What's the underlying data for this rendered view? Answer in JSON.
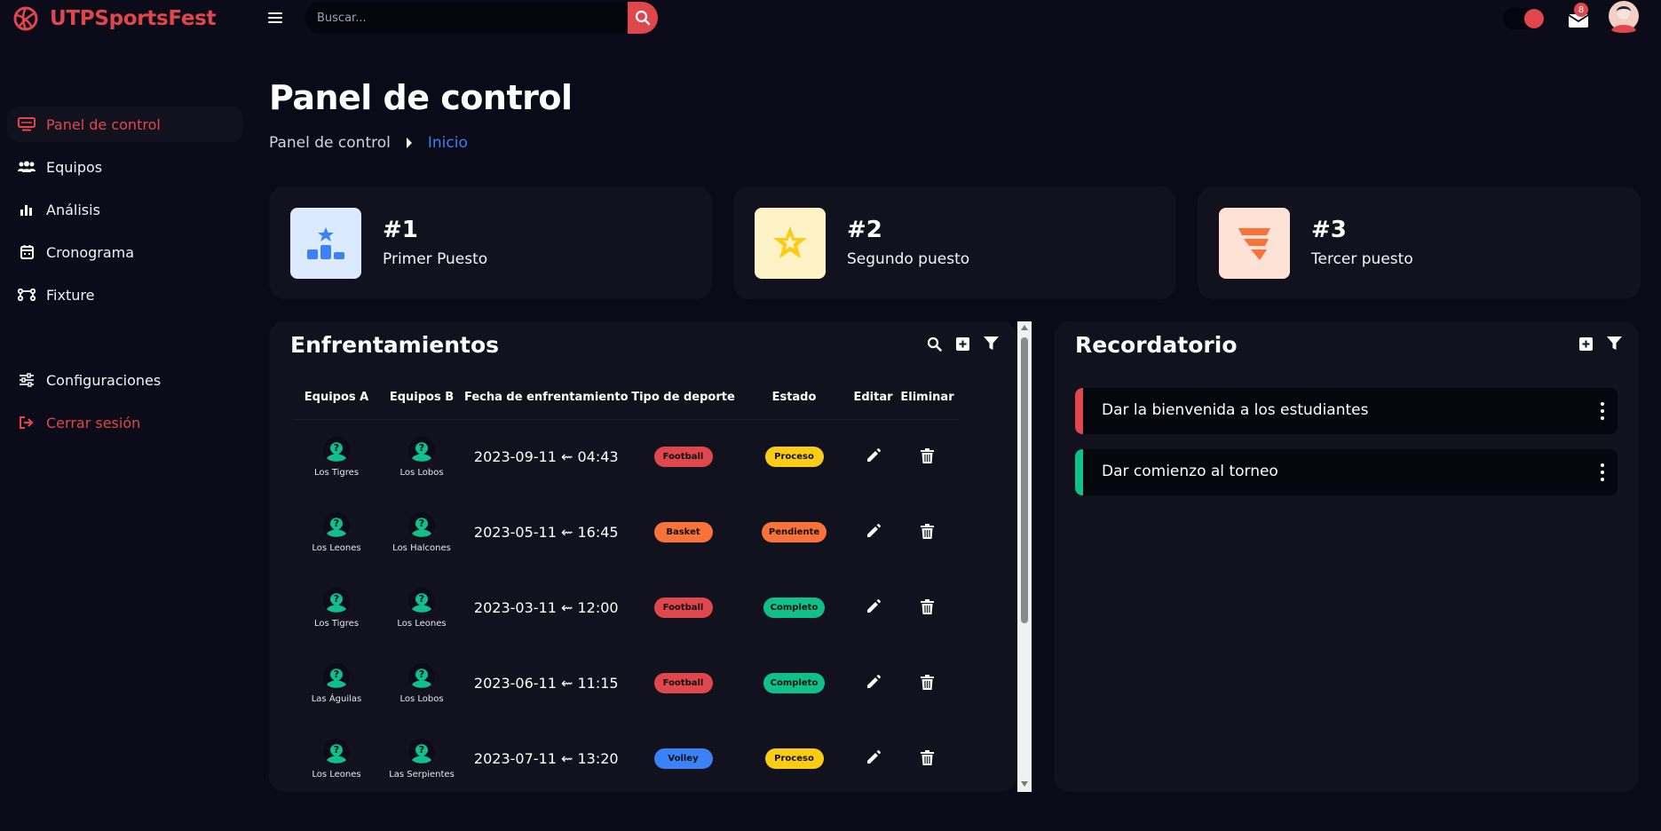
{
  "app": {
    "name": "UTPSportsFest",
    "accent": "#e0474c"
  },
  "search": {
    "placeholder": "Buscar..."
  },
  "notifications": {
    "count": "8"
  },
  "sidebar": {
    "items": [
      {
        "label": "Panel de control",
        "icon": "dashboard-icon"
      },
      {
        "label": "Equipos",
        "icon": "users-icon"
      },
      {
        "label": "Análisis",
        "icon": "bar-chart-icon"
      },
      {
        "label": "Cronograma",
        "icon": "calendar-icon"
      },
      {
        "label": "Fixture",
        "icon": "bracket-icon"
      },
      {
        "label": "Configuraciones",
        "icon": "sliders-icon"
      },
      {
        "label": "Cerrar sesión",
        "icon": "logout-icon"
      }
    ]
  },
  "page": {
    "title": "Panel de control",
    "breadcrumb": {
      "first": "Panel de control",
      "current": "Inicio"
    }
  },
  "cards": [
    {
      "rank": "#1",
      "label": "Primer Puesto",
      "icon": "podium-icon",
      "bg": "#dbeafe"
    },
    {
      "rank": "#2",
      "label": "Segundo puesto",
      "icon": "star-icon",
      "bg": "#fef3c7"
    },
    {
      "rank": "#3",
      "label": "Tercer puesto",
      "icon": "stack-icon",
      "bg": "#fee2d5"
    }
  ],
  "matches": {
    "title": "Enfrentamientos",
    "columns": [
      "Equipos A",
      "Equipos B",
      "Fecha de enfrentamiento",
      "Tipo de deporte",
      "Estado",
      "Editar",
      "Eliminar"
    ],
    "rows": [
      {
        "team_a": "Los Tigres",
        "team_b": "Los Lobos",
        "date": "2023-09-11 ⇜ 04:43",
        "sport": "Football",
        "status": "Proceso"
      },
      {
        "team_a": "Los Leones",
        "team_b": "Los Halcones",
        "date": "2023-05-11 ⇜ 16:45",
        "sport": "Basket",
        "status": "Pendiente"
      },
      {
        "team_a": "Los Tigres",
        "team_b": "Los Leones",
        "date": "2023-03-11 ⇜ 12:00",
        "sport": "Football",
        "status": "Completo"
      },
      {
        "team_a": "Las Águilas",
        "team_b": "Los Lobos",
        "date": "2023-06-11 ⇜ 11:15",
        "sport": "Football",
        "status": "Completo"
      },
      {
        "team_a": "Los Leones",
        "team_b": "Las Serpientes",
        "date": "2023-07-11 ⇜ 13:20",
        "sport": "Volley",
        "status": "Proceso"
      }
    ],
    "sport_colors": {
      "Football": "#e0474c",
      "Basket": "#f97339",
      "Volley": "#3b82f6"
    },
    "status_colors": {
      "Proceso": "#facc15",
      "Pendiente": "#f97339",
      "Completo": "#10c08a"
    }
  },
  "reminders": {
    "title": "Recordatorio",
    "items": [
      {
        "text": "Dar la bienvenida a los estudiantes",
        "color": "#e0474c"
      },
      {
        "text": "Dar comienzo al torneo",
        "color": "#10c08a"
      }
    ]
  }
}
